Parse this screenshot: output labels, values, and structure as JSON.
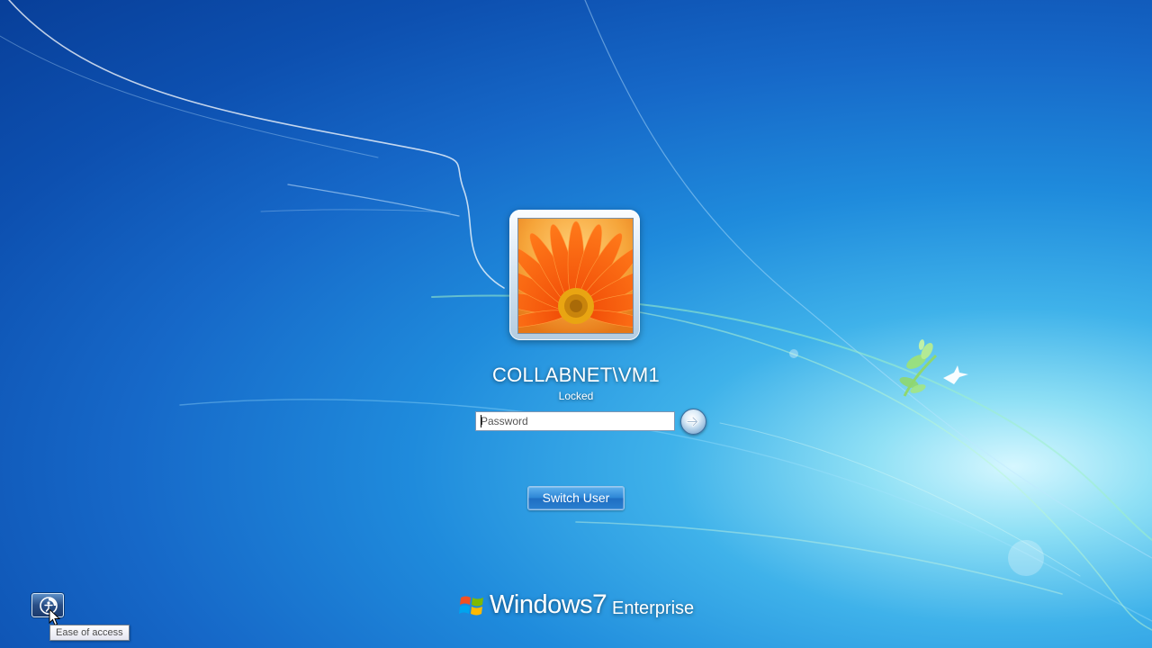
{
  "user": {
    "account_name": "COLLABNET\\VM1",
    "status": "Locked",
    "tile_image": "orange-gerbera-flower"
  },
  "login": {
    "password_placeholder": "Password",
    "password_value": "",
    "submit_icon": "arrow-right-icon"
  },
  "actions": {
    "switch_user_label": "Switch User"
  },
  "accessibility": {
    "button_icon": "ease-of-access-icon",
    "tooltip": "Ease of access"
  },
  "branding": {
    "name": "Windows",
    "version": "7",
    "edition": "Enterprise"
  },
  "colors": {
    "background_deep": "#0d50b0",
    "background_glow": "#d6f7ff",
    "accent": "#1f8bdc",
    "text": "#ffffff"
  }
}
